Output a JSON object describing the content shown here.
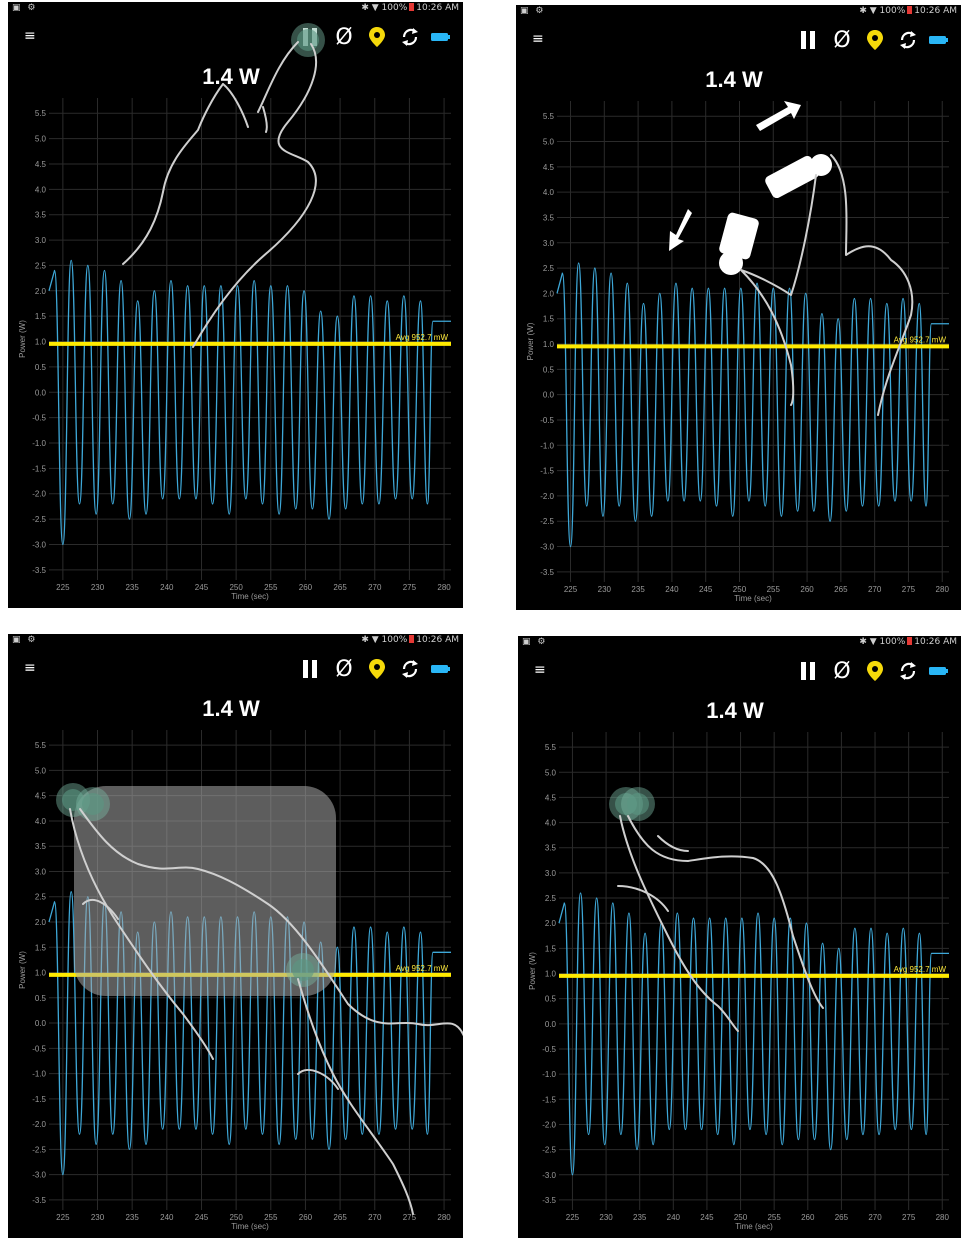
{
  "status_bar": {
    "left_icons": [
      "image-icon",
      "usb-icon"
    ],
    "battery_percent": "100%",
    "time": "10:26 AM"
  },
  "toolbar": {
    "menu": "menu-icon",
    "pause": "pause-icon",
    "zero": "Ø",
    "marker": "location-pin-icon",
    "refresh": "refresh-icon",
    "battery": "battery-icon"
  },
  "readout": {
    "power": "1.4 W"
  },
  "colors": {
    "trace": "#3ea8d8",
    "average": "#ffea00",
    "marker": "#f5d90a",
    "battery": "#29b6f6",
    "background": "#000000"
  },
  "gestures": [
    {
      "panel": "top-left",
      "name": "tap"
    },
    {
      "panel": "top-right",
      "name": "zoom"
    },
    {
      "panel": "bottom-left",
      "name": "pan"
    },
    {
      "panel": "bottom-right",
      "name": "two-finger-tap"
    }
  ],
  "chart_data": {
    "type": "line",
    "xlabel": "Time (sec)",
    "ylabel": "Power (W)",
    "xlim": [
      223,
      281
    ],
    "ylim": [
      -3.7,
      5.8
    ],
    "xticks": [
      "225",
      "230",
      "235",
      "240",
      "245",
      "250",
      "255",
      "260",
      "265",
      "270",
      "275",
      "280"
    ],
    "yticks": [
      "5.5",
      "5.0",
      "4.5",
      "4.0",
      "3.5",
      "3.0",
      "2.5",
      "2.0",
      "1.5",
      "1.0",
      "0.5",
      "0.0",
      "-0.5",
      "-1.0",
      "-1.5",
      "-2.0",
      "-2.5",
      "-3.0",
      "-3.5"
    ],
    "average": {
      "value": 0.9527,
      "label": "Avg 952.7 mW"
    },
    "series": [
      {
        "peaks_x": [
          223.8,
          226.2,
          228.6,
          231.0,
          233.4,
          235.8,
          238.2,
          240.6,
          243.0,
          245.4,
          247.8,
          250.2,
          252.6,
          255.0,
          257.4,
          259.8,
          262.2,
          264.6,
          267.0,
          269.4,
          271.8,
          274.2,
          276.6,
          278.4
        ],
        "peaks_y": [
          2.4,
          2.6,
          2.5,
          2.4,
          2.2,
          1.8,
          2.0,
          2.2,
          2.1,
          2.1,
          2.1,
          2.1,
          2.2,
          2.1,
          2.1,
          2.0,
          1.6,
          1.5,
          1.9,
          1.9,
          1.8,
          1.9,
          1.8,
          1.4
        ],
        "troughs_x": [
          225.0,
          227.4,
          229.8,
          232.2,
          234.6,
          237.0,
          239.4,
          241.8,
          244.2,
          246.6,
          249.0,
          251.4,
          253.8,
          256.2,
          258.6,
          261.0,
          263.4,
          265.8,
          268.2,
          270.6,
          273.0,
          275.4,
          277.6
        ],
        "troughs_y": [
          -3.0,
          -2.2,
          -2.4,
          -2.2,
          -2.5,
          -2.4,
          -2.1,
          -2.1,
          -2.1,
          -2.2,
          -2.4,
          -2.1,
          -2.2,
          -2.4,
          -2.3,
          -2.3,
          -2.5,
          -2.3,
          -2.2,
          -2.2,
          -2.1,
          -2.1,
          -2.2
        ],
        "end": [
          281.0,
          1.4
        ]
      }
    ]
  }
}
